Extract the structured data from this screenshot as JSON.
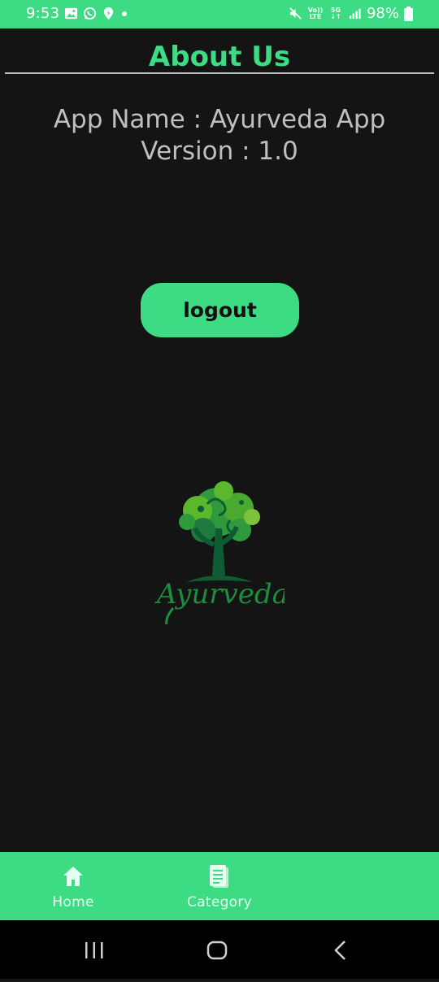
{
  "status_bar": {
    "time": "9:53",
    "battery": "98%",
    "network": "5G",
    "volte": "Vo)) LTE",
    "icons": [
      "gallery-icon",
      "whatsapp-icon",
      "location-icon",
      "dot-icon",
      "mute-icon",
      "volte-icon",
      "5g-icon",
      "signal-icon",
      "battery-icon"
    ]
  },
  "page": {
    "title": "About Us",
    "app_name": "App Name : Ayurveda App",
    "version": "Version : 1.0",
    "logout_label": "logout"
  },
  "logo": {
    "text": "Ayurveda",
    "colors": {
      "leaf_light": "#5ab82a",
      "leaf_mid": "#2e9a3c",
      "trunk": "#0f5c34"
    }
  },
  "bottom_nav": {
    "items": [
      {
        "label": "Home",
        "icon": "home-icon"
      },
      {
        "label": "Category",
        "icon": "document-icon"
      }
    ]
  },
  "system_nav": {
    "icons": [
      "recent-apps-icon",
      "home-circle-icon",
      "back-icon"
    ]
  },
  "colors": {
    "accent": "#3ddc84",
    "background": "#141414",
    "text_secondary": "#bfbfbf",
    "divider": "#bdbdbd"
  }
}
